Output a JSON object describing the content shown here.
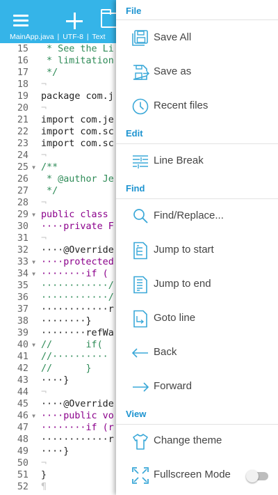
{
  "toolbar": {
    "menu_icon": "hamburger-icon",
    "new_icon": "plus-icon",
    "open_icon": "folder-icon",
    "filename": "MainApp.java",
    "separator": "|",
    "encoding": "UTF-8",
    "file_type": "Text"
  },
  "editor": {
    "line_numbers": [
      "15",
      "16",
      "17",
      "18",
      "19",
      "20",
      "21",
      "22",
      "23",
      "24",
      "25",
      "26",
      "27",
      "28",
      "29",
      "30",
      "31",
      "32",
      "33",
      "34",
      "35",
      "36",
      "37",
      "38",
      "39",
      "40",
      "41",
      "42",
      "43",
      "44",
      "45",
      "46",
      "47",
      "48",
      "49",
      "50",
      "51",
      "52"
    ],
    "code": {
      "l15": " * See the Li",
      "l16": " * limitation",
      "l17": " */",
      "l19": "package com.j",
      "l21": "import com.je",
      "l22": "import com.sc",
      "l23": "import com.sc",
      "l25": "/**",
      "l26": " * @author Je",
      "l27": " */",
      "l29": "public class",
      "l30": "····private F",
      "l32": "····@Override",
      "l33": "····protected",
      "l34": "········if (",
      "l35": "············/",
      "l36": "············/",
      "l37": "············r",
      "l38": "········}",
      "l39": "········refWa",
      "l40": "//      if(",
      "l41": "//··········",
      "l42": "//      }",
      "l43": "····}",
      "l45": "····@Override",
      "l46": "····public vo",
      "l47": "········if (r",
      "l48": "············r",
      "l49": "····}",
      "l51": "}",
      "l52": "¶",
      "return_mark": "¬"
    }
  },
  "menu": {
    "sections": {
      "file": "File",
      "edit": "Edit",
      "find": "Find",
      "view": "View"
    },
    "items": {
      "save_all": "Save All",
      "save_as": "Save as",
      "recent_files": "Recent files",
      "line_break": "Line Break",
      "find_replace": "Find/Replace...",
      "jump_to_start": "Jump to start",
      "jump_to_end": "Jump to end",
      "goto_line": "Goto line",
      "back": "Back",
      "forward": "Forward",
      "change_theme": "Change theme",
      "fullscreen_mode": "Fullscreen Mode"
    },
    "fullscreen_enabled": false
  },
  "colors": {
    "accent": "#35b4e8",
    "section_title": "#1c93d0",
    "icon": "#3aa8d8",
    "comment": "#2e8b57",
    "keyword": "#8b008b"
  }
}
